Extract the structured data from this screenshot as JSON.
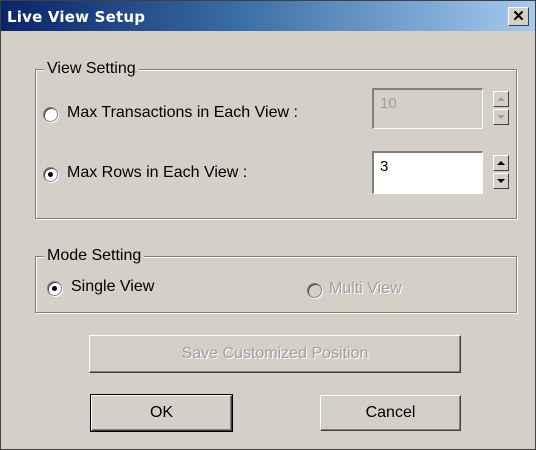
{
  "window": {
    "title": "Live View Setup",
    "close_glyph": "✕"
  },
  "view_setting": {
    "legend": "View Setting",
    "max_transactions": {
      "label": "Max Transactions in Each View :",
      "value": "10",
      "selected": false,
      "enabled": false
    },
    "max_rows": {
      "label": "Max Rows in Each View :",
      "value": "3",
      "selected": true,
      "enabled": true
    }
  },
  "mode_setting": {
    "legend": "Mode Setting",
    "single_view": {
      "label": "Single View",
      "selected": true,
      "enabled": true
    },
    "multi_view": {
      "label": "Multi View",
      "selected": false,
      "enabled": false
    }
  },
  "buttons": {
    "save_position": "Save Customized Position",
    "ok": "OK",
    "cancel": "Cancel"
  },
  "colors": {
    "window_bg": "#d4d0c8",
    "title_start": "#0a246a",
    "title_end": "#a6caf0",
    "disabled_text": "#a0a0a0"
  }
}
